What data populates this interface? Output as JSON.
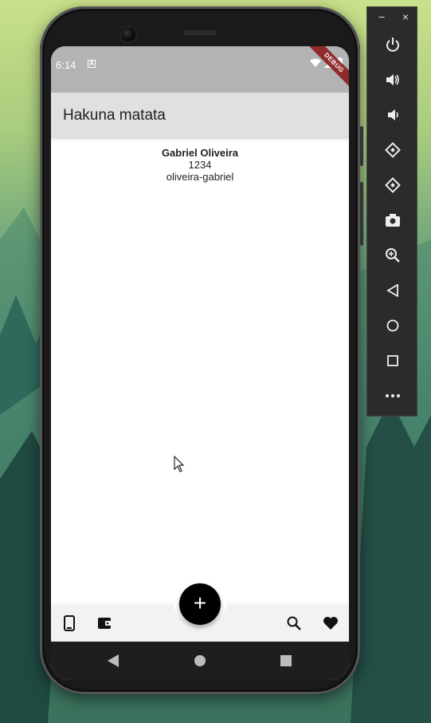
{
  "status_bar": {
    "time": "6:14",
    "notification_glyph": "A",
    "debug_label": "DEBUG"
  },
  "app_bar": {
    "title": "Hakuna matata"
  },
  "profile": {
    "name": "Gabriel Oliveira",
    "id": "1234",
    "username": "oliveira-gabriel"
  },
  "bottom_bar": {
    "left_icons": [
      "phone-icon",
      "wallet-icon"
    ],
    "right_icons": [
      "search-icon",
      "heart-icon"
    ],
    "fab_label": "+"
  },
  "emulator_toolbar": {
    "minimize": "−",
    "close": "×",
    "buttons": [
      "power-icon",
      "volume-up-icon",
      "volume-down-icon",
      "rotate-left-icon",
      "rotate-right-icon",
      "camera-icon",
      "zoom-icon",
      "back-icon",
      "home-icon",
      "overview-icon",
      "more-icon"
    ]
  },
  "colors": {
    "status_bar": "#b3b3b3",
    "app_bar": "#e0e0e0",
    "fab": "#000000",
    "nav_bar": "#1e1e1e",
    "toolbar": "#2b2b2b"
  }
}
